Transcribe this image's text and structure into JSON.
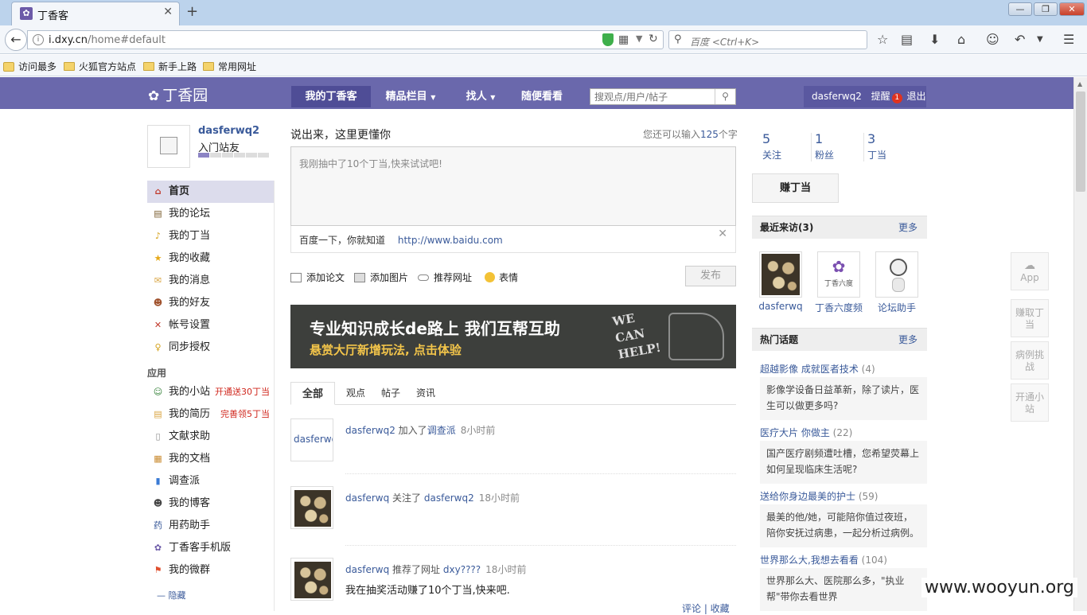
{
  "browser": {
    "tab_title": "丁香客",
    "url_host": "i.dxy.cn",
    "url_path": "/home#default",
    "search_placeholder": "百度 <Ctrl+K>",
    "bookmarks": [
      "访问最多",
      "火狐官方站点",
      "新手上路",
      "常用网址"
    ]
  },
  "site": {
    "logo": "丁香园",
    "nav": [
      "我的丁香客",
      "精品栏目",
      "找人",
      "随便看看"
    ],
    "search_placeholder": "搜观点/用户/帖子",
    "username": "dasferwq2",
    "remind_label": "提醒",
    "remind_count": "1",
    "logout": "退出"
  },
  "profile": {
    "name": "dasferwq2",
    "level": "入门站友",
    "level_progress": 0.17
  },
  "leftnav": [
    {
      "label": "首页",
      "icon": "home-icon",
      "active": true
    },
    {
      "label": "我的论坛",
      "icon": "forum-icon"
    },
    {
      "label": "我的丁当",
      "icon": "bell-icon"
    },
    {
      "label": "我的收藏",
      "icon": "star-icon"
    },
    {
      "label": "我的消息",
      "icon": "mail-icon"
    },
    {
      "label": "我的好友",
      "icon": "friends-icon"
    },
    {
      "label": "帐号设置",
      "icon": "tools-icon"
    },
    {
      "label": "同步授权",
      "icon": "key-icon"
    }
  ],
  "apps": {
    "title": "应用",
    "items": [
      {
        "label": "我的小站",
        "promo": "开通送30丁当"
      },
      {
        "label": "我的简历",
        "promo": "完善领5丁当"
      },
      {
        "label": "文献求助"
      },
      {
        "label": "我的文档"
      },
      {
        "label": "调查派"
      },
      {
        "label": "我的博客"
      },
      {
        "label": "用药助手"
      },
      {
        "label": "丁香客手机版"
      },
      {
        "label": "我的微群"
      }
    ],
    "hide": "隐藏"
  },
  "composer": {
    "title": "说出来，这里更懂你",
    "counter_prefix": "您还可以输入",
    "counter_value": "125",
    "counter_suffix": "个字",
    "text": "我刚抽中了10个丁当,快来试试吧!",
    "link_title": "百度一下，你就知道",
    "link_url": "http://www.baidu.com",
    "tools": [
      "添加论文",
      "添加图片",
      "推荐网址",
      "表情"
    ],
    "publish": "发布"
  },
  "banner": {
    "line1": "专业知识成长de路上 我们互帮互助",
    "line2": "悬赏大厅新增玩法, 点击体验",
    "help_text": "WE CAN HELP!"
  },
  "feed_tabs": [
    "全部",
    "观点",
    "帖子",
    "资讯"
  ],
  "feed": [
    {
      "avatar_text": "dasferwq",
      "user": "dasferwq2",
      "action": "加入了",
      "target": "调查派",
      "time": "8小时前"
    },
    {
      "user": "dasferwq",
      "action": "关注了",
      "target": "dasferwq2",
      "time": "18小时前"
    },
    {
      "user": "dasferwq",
      "action": "推荐了网址",
      "target": "dxy????",
      "time": "18小时前",
      "content": "我在抽奖活动赚了10个丁当,快来吧."
    }
  ],
  "feed_actions": "评论 | 收藏",
  "stats": [
    {
      "num": "5",
      "label": "关注"
    },
    {
      "num": "1",
      "label": "粉丝"
    },
    {
      "num": "3",
      "label": "丁当"
    }
  ],
  "earn_button": "赚丁当",
  "visitors": {
    "title": "最近来访(3)",
    "more": "更多",
    "items": [
      "dasferwq",
      "丁香六度频",
      "论坛助手"
    ],
    "logo_caption": "丁香六度"
  },
  "topics": {
    "title": "热门话题",
    "more": "更多",
    "items": [
      {
        "title": "超越影像 成就医者技术",
        "count": "(4)",
        "desc": "影像学设备日益革新，除了读片，医生可以做更多吗?"
      },
      {
        "title": "医疗大片 你做主",
        "count": "(22)",
        "desc": "国产医疗剧频遭吐槽，您希望荧幕上如何呈现临床生活呢?"
      },
      {
        "title": "送给你身边最美的护士",
        "count": "(59)",
        "desc": "最美的他/她，可能陪你值过夜班，陪你安抚过病患，一起分析过病例。"
      },
      {
        "title": "世界那么大,我想去看看",
        "count": "(104)",
        "desc": "世界那么大、医院那么多，\"执业帮\"带你去看世界"
      }
    ]
  },
  "side_tools": [
    "App",
    "赚取丁当",
    "病例挑战",
    "开通小站"
  ],
  "watermark": "www.wooyun.org"
}
